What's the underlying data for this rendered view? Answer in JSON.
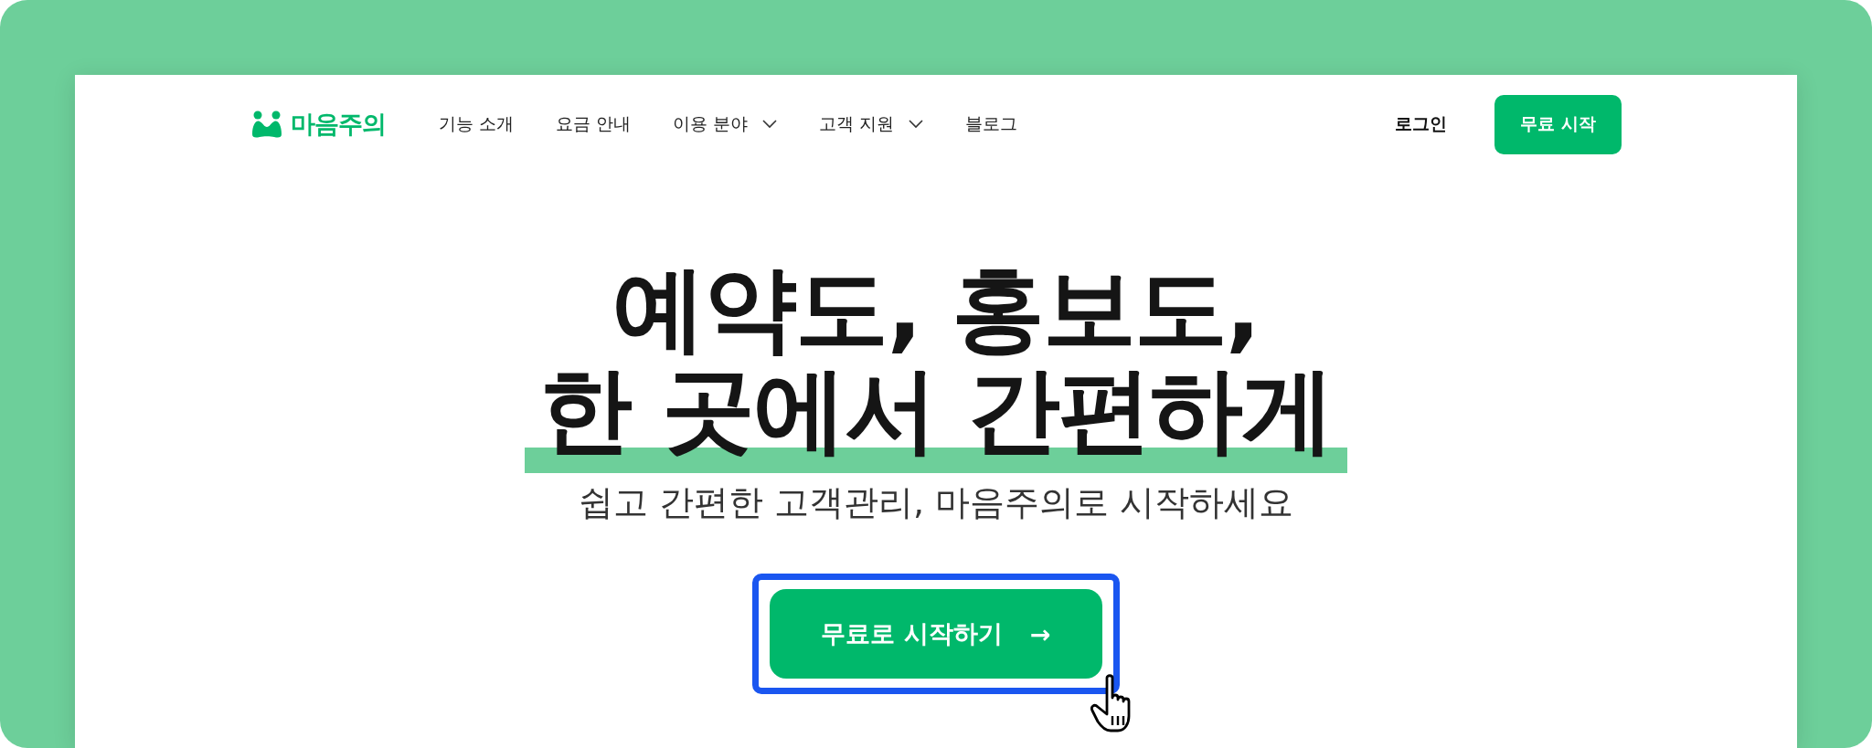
{
  "logo": {
    "text": "마음주의"
  },
  "nav": {
    "items": [
      {
        "label": "기능 소개",
        "has_dropdown": false
      },
      {
        "label": "요금 안내",
        "has_dropdown": false
      },
      {
        "label": "이용 분야",
        "has_dropdown": true
      },
      {
        "label": "고객 지원",
        "has_dropdown": true
      },
      {
        "label": "블로그",
        "has_dropdown": false
      }
    ],
    "login": "로그인",
    "start_button": "무료 시작"
  },
  "hero": {
    "headline_lines": [
      {
        "text": "예약도, 홍보도,",
        "underlined": false
      },
      {
        "text": "한 곳에서 간편하게",
        "underlined": true
      }
    ],
    "subtitle": "쉽고 간편한 고객관리, 마음주의로 시작하세요",
    "cta": {
      "label": "무료로 시작하기",
      "arrow": "→",
      "highlighted": true
    }
  }
}
